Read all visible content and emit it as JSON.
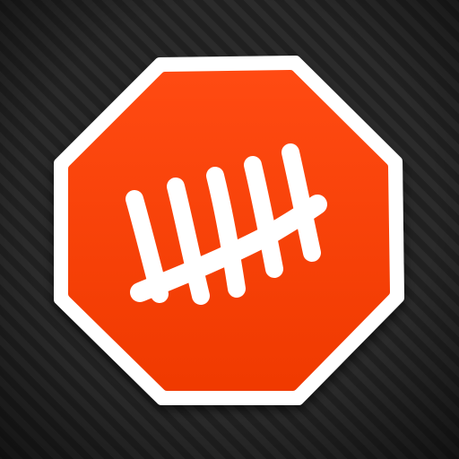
{
  "icon": {
    "name": "tally-counter-app-icon",
    "shape": "octagon-stop-sign",
    "symbol": "tally-marks",
    "tally_count": 5
  },
  "colors": {
    "background_dark": "#202020",
    "background_stripe": "#2b2b2b",
    "background_edge": "#0f0f0f",
    "octagon_fill": "#f03a00",
    "octagon_fill_highlight": "#ff4a12",
    "octagon_border": "#ffffff",
    "tally_stroke": "#ffffff"
  }
}
